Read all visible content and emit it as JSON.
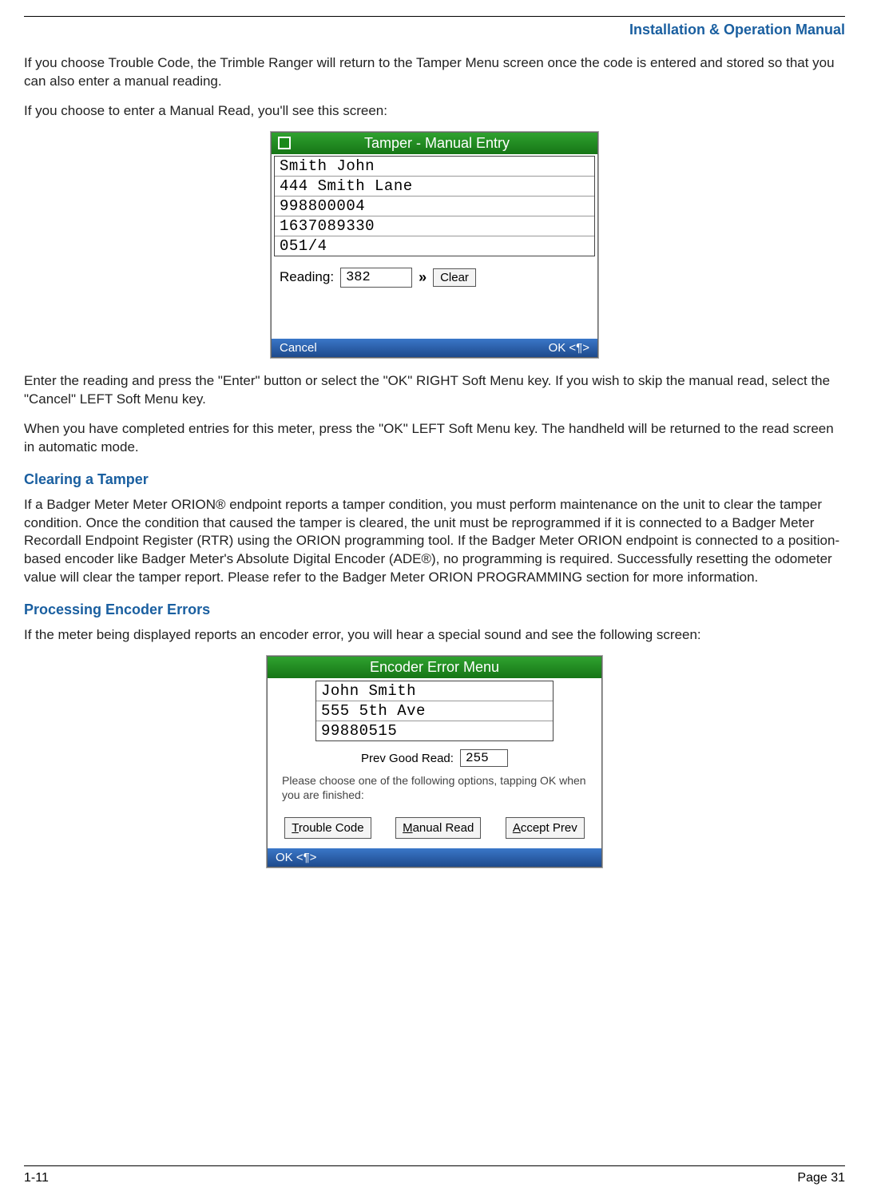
{
  "header": {
    "title": "Installation & Operation Manual"
  },
  "paragraphs": {
    "p1": "If you choose Trouble Code, the Trimble Ranger will return to the Tamper Menu screen once the code is entered and stored so that you can also enter a manual reading.",
    "p2": "If you choose to enter a Manual Read, you'll see this screen:",
    "p3": "Enter the reading and press the \"Enter\" button or select the \"OK\" RIGHT Soft Menu key.  If you wish to skip the manual read, select the \"Cancel\" LEFT Soft Menu key.",
    "p4": "When you have completed entries for this meter, press the \"OK\"  LEFT Soft Menu key.  The handheld will be returned to the read screen in automatic mode.",
    "p5": "If a Badger Meter Meter ORION® endpoint reports a tamper condition, you must perform maintenance on the unit to clear the tamper condition.  Once the condition that caused the tamper is cleared, the unit must be reprogrammed if it is connected to a Badger Meter Recordall Endpoint Register (RTR) using the ORION programming tool.  If the Badger Meter ORION endpoint is connected to a position-based encoder like Badger Meter's Absolute Digital Encoder (ADE®), no programming is required.  Successfully resetting the odometer value will clear the tamper report.  Please refer to the Badger Meter ORION PROGRAMMING section for more information.",
    "p6": "If the meter being displayed reports an encoder error, you will hear a special sound and see the following screen:"
  },
  "headings": {
    "h1": "Clearing a Tamper",
    "h2": "Processing Encoder Errors"
  },
  "screen1": {
    "title": "Tamper - Manual Entry",
    "rows": [
      "Smith John",
      "444 Smith Lane",
      "998800004",
      "1637089330",
      "051/4"
    ],
    "reading_label": "Reading:",
    "reading_value": "382",
    "chevron": "»",
    "clear_label": "Clear",
    "soft_left": "Cancel",
    "soft_right": "OK <¶>"
  },
  "screen2": {
    "title": "Encoder Error Menu",
    "rows": [
      "John Smith",
      "555 5th Ave",
      "99880515"
    ],
    "prev_label": "Prev Good Read:",
    "prev_value": "255",
    "hint": "Please choose one of the following options, tapping OK when you are finished:",
    "btn1_u": "T",
    "btn1_rest": "rouble Code",
    "btn2_u": "M",
    "btn2_rest": "anual Read",
    "btn3_u": "A",
    "btn3_rest": "ccept Prev",
    "soft_left": "OK <¶>"
  },
  "footer": {
    "left": "1-11",
    "right": "Page 31"
  }
}
